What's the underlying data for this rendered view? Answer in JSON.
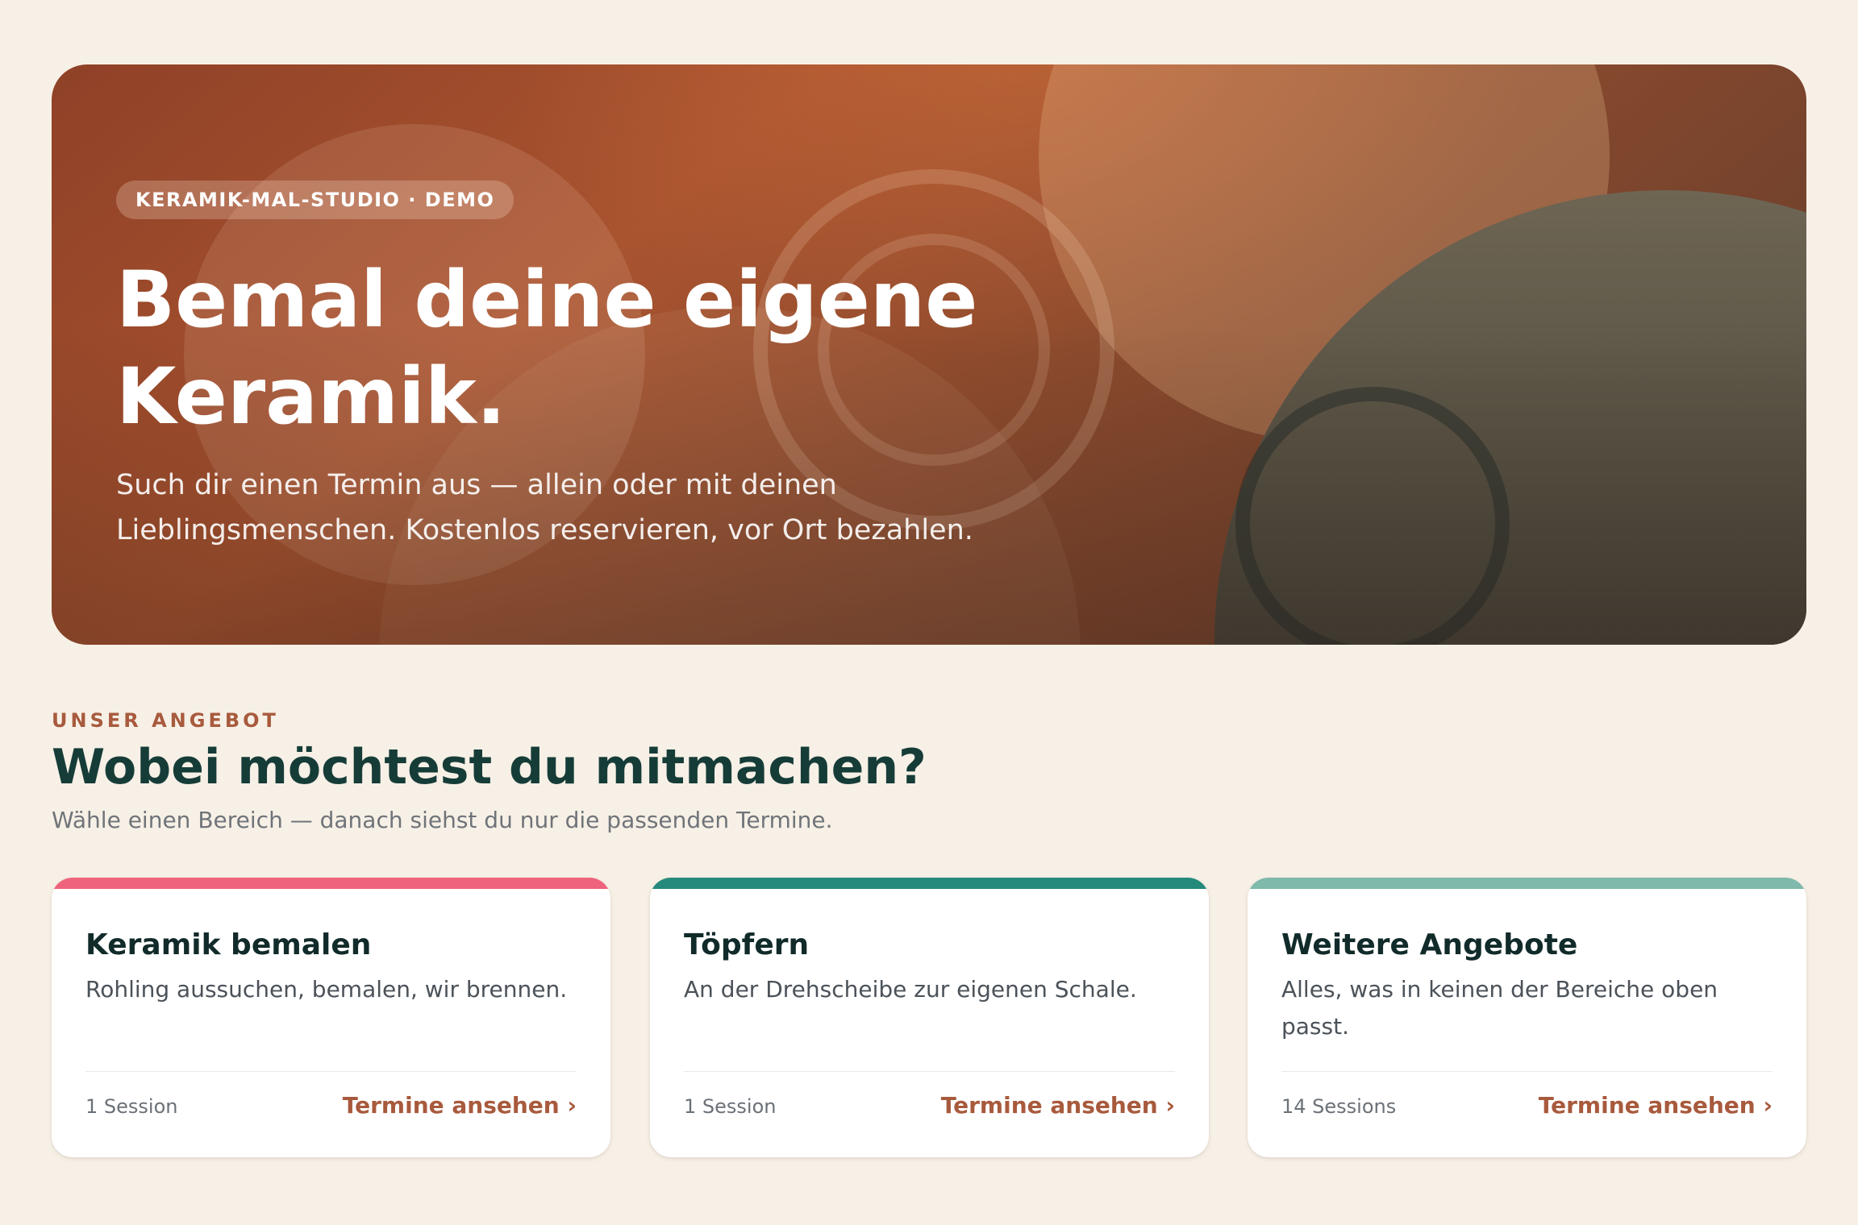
{
  "hero": {
    "badge": "KERAMIK-MAL-STUDIO · DEMO",
    "title_line1": "Bemal deine eigene",
    "title_line2": "Keramik.",
    "subtitle_line1": "Such dir einen Termin aus — allein oder mit deinen",
    "subtitle_line2": "Lieblingsmenschen. Kostenlos reservieren, vor Ort bezahlen."
  },
  "section": {
    "kicker": "UNSER ANGEBOT",
    "title": "Wobei möchtest du mitmachen?",
    "subtitle": "Wähle einen Bereich — danach siehst du nur die passenden Termine."
  },
  "cards": [
    {
      "title": "Keramik bemalen",
      "description": "Rohling aussuchen, bemalen, wir brennen.",
      "count": "1 Session",
      "link_label": "Termine ansehen ›",
      "accent": "#ef637c"
    },
    {
      "title": "Töpfern",
      "description": "An der Drehscheibe zur eigenen Schale.",
      "count": "1 Session",
      "link_label": "Termine ansehen ›",
      "accent": "#248a7b"
    },
    {
      "title": "Weitere Angebote",
      "description": "Alles, was in keinen der Bereiche oben passt.",
      "count": "14 Sessions",
      "link_label": "Termine ansehen ›",
      "accent": "#7fb9ab"
    }
  ],
  "colors": {
    "page_background": "#f7f0e6",
    "brand_terracotta": "#a85a3d",
    "heading_dark_teal": "#163c38"
  }
}
